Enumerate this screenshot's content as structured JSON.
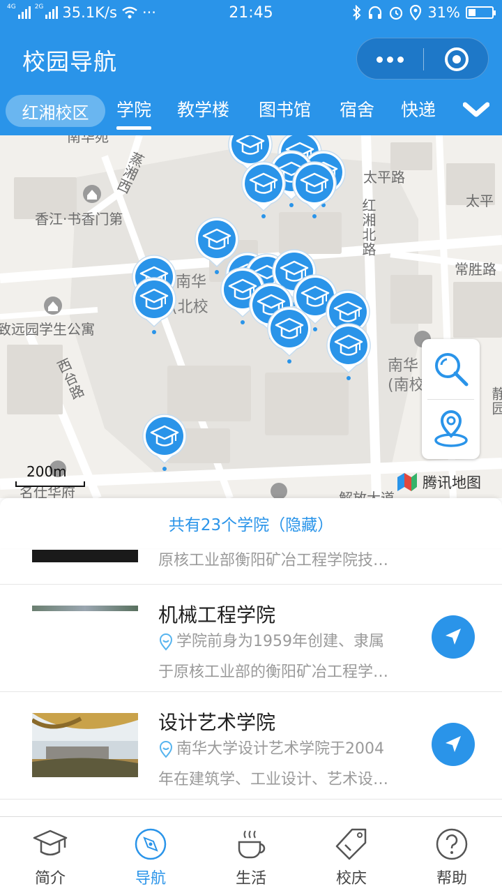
{
  "status_bar": {
    "network_left": "4G",
    "network_right": "2G",
    "speed": "35.1K/s",
    "more": "···",
    "time": "21:45",
    "battery": "31%",
    "battery_level": 0.31
  },
  "header": {
    "title": "校园导航"
  },
  "tabs": {
    "campus": "红湘校区",
    "items": [
      "学院",
      "教学楼",
      "图书馆",
      "宿舍",
      "快递"
    ],
    "active_index": 0
  },
  "map": {
    "labels": {
      "xiangjiang": "香江·书香门第",
      "taiping_road": "太平路",
      "taiping_edge": "太平",
      "hongxiang_north": "红湘北路",
      "changsheng": "常胜路",
      "zhiyuan": "致远园学生公寓",
      "nanhua_north_1": "南华",
      "nanhua_north_2": "(北校",
      "nanhua_south_1": "南华",
      "nanhua_south_2": "(南校",
      "xitai": "西台路",
      "jing": "静园",
      "mingshi": "名仕华府",
      "jiefang": "解放大道",
      "lanshan": "蒸湘西",
      "top_cut": "南华苑"
    },
    "scale": "200m",
    "provider": "腾讯地图"
  },
  "sheet": {
    "summary": "共有23个学院（隐藏）"
  },
  "colleges": [
    {
      "name": "",
      "desc": "原核工业部衡阳矿冶工程学院技…"
    },
    {
      "name": "机械工程学院",
      "desc_line1": "学院前身为1959年创建、隶属",
      "desc_line2": "于原核工业部的衡阳矿冶工程学…"
    },
    {
      "name": "设计艺术学院",
      "desc_line1": "南华大学设计艺术学院于2004",
      "desc_line2": "年在建筑学、工业设计、艺术设…"
    }
  ],
  "bottom_nav": [
    {
      "label": "简介",
      "icon": "graduation-cap-icon"
    },
    {
      "label": "导航",
      "icon": "compass-icon"
    },
    {
      "label": "生活",
      "icon": "coffee-cup-icon"
    },
    {
      "label": "校庆",
      "icon": "tag-icon"
    },
    {
      "label": "帮助",
      "icon": "help-icon"
    }
  ],
  "colors": {
    "primary": "#2a94e9",
    "pill": "#6ab6f0",
    "map_bg": "#f2f0ec"
  }
}
